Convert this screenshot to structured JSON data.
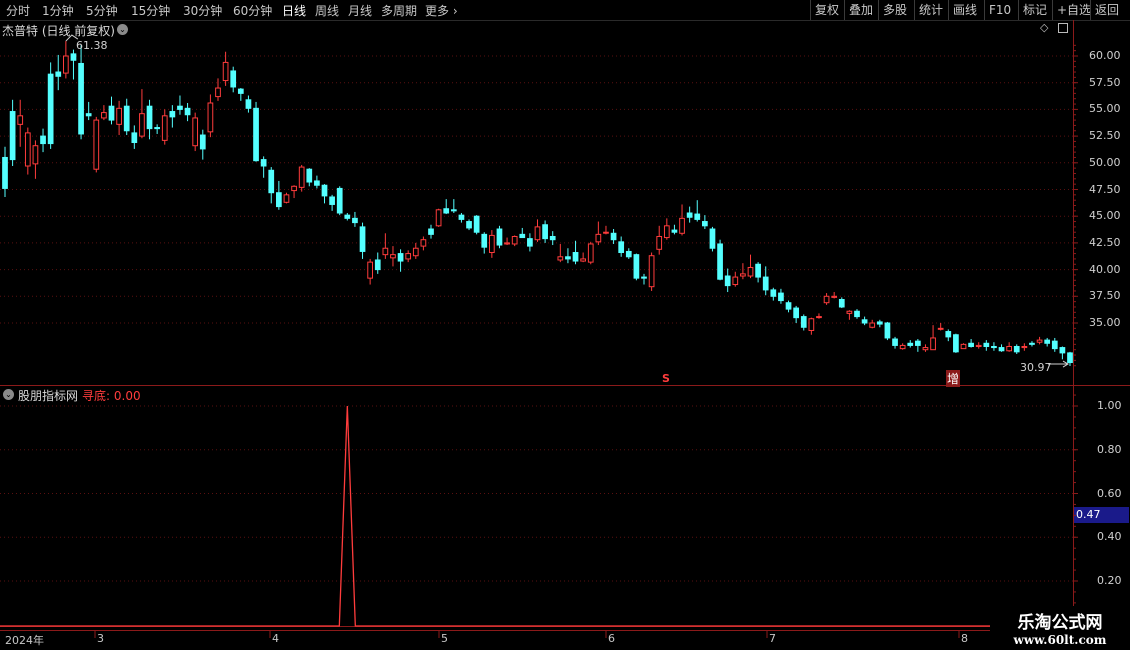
{
  "toolbar": {
    "periods": [
      "分时",
      "1分钟",
      "5分钟",
      "15分钟",
      "30分钟",
      "60分钟",
      "日线",
      "周线",
      "月线",
      "多周期",
      "更多"
    ],
    "active_period": "日线",
    "right_buttons": [
      "复权",
      "叠加",
      "多股",
      "统计",
      "画线",
      "F10",
      "标记",
      "+自选",
      "返回"
    ]
  },
  "main_panel": {
    "title": "杰普特 (日线 前复权)",
    "high_label": "61.38",
    "low_label": "30.97",
    "marker_s": "S",
    "marker_zeng": "增",
    "y_ticks": [
      "60.00",
      "57.50",
      "55.00",
      "52.50",
      "50.00",
      "47.50",
      "45.00",
      "42.50",
      "40.00",
      "37.50",
      "35.00"
    ]
  },
  "sub_panel": {
    "indicator_name": "股朋指标网",
    "indicator_label": "寻底",
    "indicator_value": "0.00",
    "cursor_value": "0.47",
    "y_ticks": [
      "1.00",
      "0.80",
      "0.60",
      "0.40",
      "0.20"
    ]
  },
  "x_axis": {
    "labels": [
      "2024年",
      "3",
      "4",
      "5",
      "6",
      "7",
      "8"
    ]
  },
  "watermark": {
    "title": "乐淘公式网",
    "url": "www.60lt.com"
  },
  "colors": {
    "up": "#ff3c3c",
    "down": "#54ffff",
    "frame": "#8b1a1a",
    "cursor_bg": "#1a1a8a"
  },
  "chart_data": [
    {
      "type": "candlestick",
      "title": "杰普特 (日线 前复权)",
      "ylim": [
        30,
        62
      ],
      "y_ticks": [
        60,
        57.5,
        55,
        52.5,
        50,
        47.5,
        45,
        42.5,
        40,
        37.5,
        35
      ],
      "annotations": [
        {
          "text": "61.38",
          "type": "high"
        },
        {
          "text": "30.97",
          "type": "low"
        }
      ],
      "candles": [
        [
          50.5,
          47.6,
          51.5,
          46.8
        ],
        [
          54.8,
          50.3,
          55.9,
          49.7
        ],
        [
          53.6,
          54.4,
          55.9,
          51.5
        ],
        [
          49.7,
          52.8,
          53.3,
          48.9
        ],
        [
          49.9,
          51.6,
          52.1,
          48.5
        ],
        [
          52.5,
          51.8,
          53.2,
          51.0
        ],
        [
          58.3,
          51.8,
          59.4,
          51.3
        ],
        [
          58.5,
          58.1,
          60.1,
          56.8
        ],
        [
          58.4,
          60.0,
          61.4,
          57.9
        ],
        [
          60.2,
          59.6,
          60.6,
          57.8
        ],
        [
          59.3,
          52.7,
          61.0,
          52.2
        ],
        [
          54.6,
          54.4,
          55.7,
          54.0
        ],
        [
          49.4,
          54.0,
          54.3,
          49.1
        ],
        [
          54.2,
          54.7,
          55.4,
          54.0
        ],
        [
          55.3,
          54.0,
          56.2,
          53.6
        ],
        [
          53.6,
          55.1,
          55.8,
          52.6
        ],
        [
          55.3,
          53.0,
          56.0,
          52.6
        ],
        [
          52.8,
          51.9,
          53.5,
          51.3
        ],
        [
          52.5,
          54.6,
          56.9,
          52.3
        ],
        [
          55.3,
          53.2,
          55.9,
          52.2
        ],
        [
          53.3,
          53.2,
          53.6,
          52.7
        ],
        [
          52.1,
          54.4,
          55.0,
          51.7
        ],
        [
          54.8,
          54.3,
          55.4,
          53.3
        ],
        [
          55.3,
          55.0,
          56.3,
          54.5
        ],
        [
          55.1,
          54.5,
          55.6,
          53.9
        ],
        [
          51.6,
          54.2,
          54.7,
          51.1
        ],
        [
          52.6,
          51.3,
          53.1,
          50.3
        ],
        [
          52.9,
          55.6,
          56.4,
          52.4
        ],
        [
          56.2,
          57.0,
          57.9,
          55.8
        ],
        [
          57.7,
          59.4,
          60.4,
          57.2
        ],
        [
          58.6,
          57.1,
          59.0,
          56.6
        ],
        [
          56.9,
          56.5,
          57.0,
          55.8
        ],
        [
          55.9,
          55.1,
          56.3,
          54.7
        ],
        [
          55.1,
          50.2,
          55.7,
          50.1
        ],
        [
          50.3,
          49.7,
          50.6,
          48.6
        ],
        [
          49.3,
          47.2,
          49.6,
          46.2
        ],
        [
          47.2,
          45.9,
          48.3,
          45.6
        ],
        [
          46.3,
          47.0,
          47.2,
          46.2
        ],
        [
          47.4,
          47.8,
          47.9,
          46.7
        ],
        [
          47.7,
          49.6,
          49.8,
          47.3
        ],
        [
          49.4,
          48.2,
          49.5,
          47.8
        ],
        [
          48.3,
          47.9,
          48.8,
          47.6
        ],
        [
          47.9,
          46.9,
          48.0,
          46.2
        ],
        [
          46.8,
          46.1,
          47.0,
          45.5
        ],
        [
          47.6,
          45.3,
          47.8,
          45.1
        ],
        [
          45.1,
          44.8,
          45.3,
          44.6
        ],
        [
          44.8,
          44.4,
          45.4,
          44.0
        ],
        [
          44.0,
          41.7,
          44.4,
          41.0
        ],
        [
          39.2,
          40.7,
          41.0,
          38.6
        ],
        [
          40.9,
          40.0,
          41.6,
          39.6
        ],
        [
          41.4,
          42.0,
          43.4,
          41.0
        ],
        [
          41.1,
          41.4,
          42.2,
          40.3
        ],
        [
          41.5,
          40.8,
          41.9,
          39.8
        ],
        [
          41.0,
          41.5,
          41.8,
          40.7
        ],
        [
          41.3,
          42.0,
          42.5,
          41.0
        ],
        [
          42.2,
          42.8,
          43.1,
          41.8
        ],
        [
          43.8,
          43.3,
          44.2,
          42.9
        ],
        [
          44.1,
          45.6,
          45.7,
          44.0
        ],
        [
          45.7,
          45.3,
          46.6,
          45.2
        ],
        [
          45.6,
          45.5,
          46.6,
          45.3
        ],
        [
          45.1,
          44.7,
          45.3,
          44.4
        ],
        [
          44.5,
          43.9,
          44.7,
          43.7
        ],
        [
          45.0,
          43.5,
          45.1,
          43.3
        ],
        [
          43.3,
          42.1,
          43.5,
          41.5
        ],
        [
          41.6,
          43.2,
          43.7,
          41.1
        ],
        [
          43.8,
          42.3,
          44.1,
          42.0
        ],
        [
          42.4,
          42.5,
          43.0,
          42.3
        ],
        [
          42.4,
          43.1,
          43.2,
          42.2
        ],
        [
          43.3,
          43.0,
          43.9,
          43.0
        ],
        [
          42.9,
          42.2,
          43.4,
          41.7
        ],
        [
          42.8,
          44.0,
          44.7,
          42.6
        ],
        [
          44.2,
          42.9,
          44.6,
          42.5
        ],
        [
          43.1,
          42.8,
          43.6,
          42.3
        ],
        [
          40.9,
          41.2,
          42.4,
          40.7
        ],
        [
          41.2,
          41.0,
          42.0,
          40.6
        ],
        [
          41.6,
          40.8,
          42.7,
          40.5
        ],
        [
          40.8,
          41.0,
          41.6,
          40.7
        ],
        [
          40.7,
          42.4,
          42.6,
          40.5
        ],
        [
          42.6,
          43.3,
          44.5,
          42.3
        ],
        [
          43.5,
          43.5,
          44.1,
          43.3
        ],
        [
          43.4,
          42.8,
          43.8,
          42.4
        ],
        [
          42.6,
          41.6,
          43.1,
          41.2
        ],
        [
          41.7,
          41.2,
          42.0,
          41.0
        ],
        [
          41.4,
          39.2,
          41.5,
          39.0
        ],
        [
          39.3,
          39.2,
          39.6,
          38.6
        ],
        [
          38.4,
          41.3,
          41.6,
          38.0
        ],
        [
          41.9,
          43.1,
          44.1,
          41.4
        ],
        [
          43.0,
          44.1,
          44.8,
          42.8
        ],
        [
          43.7,
          43.5,
          44.2,
          43.3
        ],
        [
          43.4,
          44.8,
          46.1,
          43.2
        ],
        [
          45.3,
          44.9,
          45.9,
          44.4
        ],
        [
          45.2,
          44.7,
          46.5,
          44.5
        ],
        [
          44.5,
          44.1,
          45.1,
          43.8
        ],
        [
          43.8,
          42.0,
          44.0,
          41.7
        ],
        [
          42.4,
          39.1,
          42.8,
          39.0
        ],
        [
          39.4,
          38.5,
          40.1,
          37.9
        ],
        [
          38.6,
          39.3,
          39.8,
          38.4
        ],
        [
          39.4,
          39.6,
          40.6,
          39.1
        ],
        [
          39.4,
          40.2,
          41.4,
          39.2
        ],
        [
          40.5,
          39.3,
          40.7,
          38.8
        ],
        [
          39.3,
          38.1,
          40.3,
          37.6
        ],
        [
          38.1,
          37.5,
          38.3,
          37.1
        ],
        [
          37.8,
          37.1,
          38.2,
          36.8
        ],
        [
          36.9,
          36.3,
          37.1,
          36.0
        ],
        [
          36.4,
          35.5,
          36.6,
          35.0
        ],
        [
          35.6,
          34.6,
          35.8,
          34.3
        ],
        [
          34.3,
          35.4,
          35.5,
          33.9
        ],
        [
          35.6,
          35.6,
          35.9,
          35.4
        ],
        [
          36.9,
          37.5,
          37.8,
          36.7
        ],
        [
          37.4,
          37.5,
          37.9,
          37.3
        ],
        [
          37.2,
          36.5,
          37.4,
          36.4
        ],
        [
          35.9,
          36.1,
          36.2,
          35.3
        ],
        [
          36.1,
          35.6,
          36.3,
          35.4
        ],
        [
          35.3,
          35.0,
          35.6,
          34.8
        ],
        [
          34.6,
          35.0,
          35.3,
          34.5
        ],
        [
          35.1,
          34.9,
          35.3,
          34.6
        ],
        [
          35.0,
          33.6,
          35.1,
          33.4
        ],
        [
          33.5,
          32.9,
          33.7,
          32.6
        ],
        [
          32.6,
          32.9,
          33.1,
          32.5
        ],
        [
          33.1,
          32.9,
          33.4,
          32.7
        ],
        [
          33.3,
          32.9,
          33.5,
          32.3
        ],
        [
          32.5,
          32.7,
          33.0,
          32.3
        ],
        [
          32.5,
          33.6,
          34.8,
          32.5
        ],
        [
          34.5,
          34.5,
          35.0,
          34.3
        ],
        [
          34.2,
          33.7,
          34.4,
          33.3
        ],
        [
          33.9,
          32.3,
          34.0,
          32.2
        ],
        [
          32.6,
          33.0,
          33.1,
          32.6
        ],
        [
          33.1,
          32.8,
          33.5,
          32.7
        ],
        [
          32.8,
          32.9,
          33.2,
          32.6
        ],
        [
          33.1,
          32.8,
          33.4,
          32.4
        ],
        [
          32.8,
          32.7,
          33.2,
          32.4
        ],
        [
          32.7,
          32.4,
          33.0,
          32.3
        ],
        [
          32.4,
          32.8,
          33.2,
          32.3
        ],
        [
          32.8,
          32.3,
          33.0,
          32.1
        ],
        [
          32.7,
          32.8,
          33.1,
          32.4
        ],
        [
          33.1,
          33.0,
          33.3,
          32.8
        ],
        [
          33.2,
          33.4,
          33.7,
          33.0
        ],
        [
          33.4,
          33.1,
          33.6,
          32.8
        ],
        [
          33.3,
          32.6,
          33.6,
          32.3
        ],
        [
          32.7,
          32.2,
          32.8,
          31.6
        ],
        [
          32.2,
          31.3,
          32.3,
          30.97
        ]
      ]
    },
    {
      "type": "line",
      "title": "股朋指标网",
      "series": [
        {
          "name": "寻底",
          "peak_index": 45,
          "values_desc": "0 everywhere except a single spike to 1.00 in April"
        }
      ],
      "ylim": [
        0,
        1.05
      ],
      "y_ticks": [
        1.0,
        0.8,
        0.6,
        0.4,
        0.2
      ]
    }
  ]
}
